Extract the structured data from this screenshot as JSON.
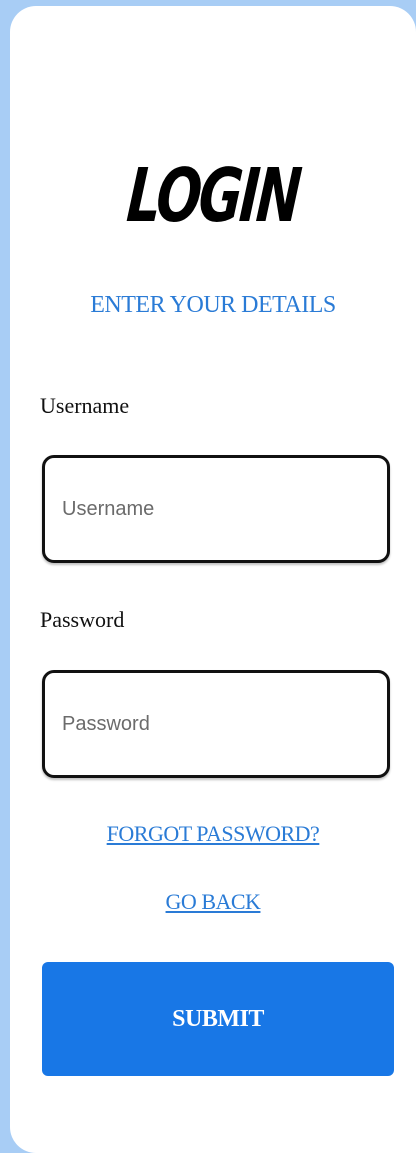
{
  "login": {
    "title": "LOGIN",
    "subtitle": "ENTER YOUR DETAILS",
    "username_label": "Username",
    "username_placeholder": "Username",
    "username_value": "",
    "password_label": "Password",
    "password_placeholder": "Password",
    "password_value": "",
    "forgot_link": "FORGOT PASSWORD?",
    "back_link": "GO BACK",
    "submit_label": "SUBMIT"
  },
  "colors": {
    "background": "#a8cdf5",
    "accent": "#1877e6",
    "link": "#2a7bd6"
  }
}
